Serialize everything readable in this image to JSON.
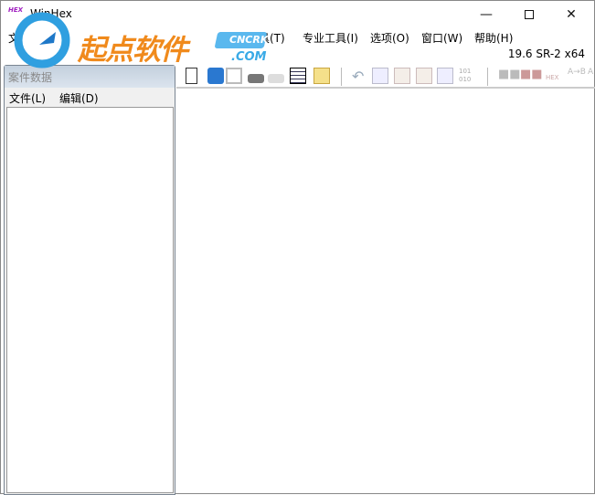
{
  "window": {
    "title": "WinHex",
    "app_icon_text": "HEX",
    "controls": [
      "minimize",
      "maximize",
      "close"
    ]
  },
  "menubar": {
    "items": [
      "文",
      "具(T)",
      "专业工具(I)",
      "选项(O)",
      "窗口(W)",
      "帮助(H)"
    ]
  },
  "version": "19.6 SR-2 x64",
  "toolbar": {
    "icons": [
      "new-file",
      "open",
      "save",
      "disk",
      "print",
      "properties",
      "export",
      "undo",
      "copy",
      "paste",
      "paste-special",
      "compare",
      "binary-convert",
      "find",
      "find-hex",
      "find-hex-2",
      "replace",
      "replace-hex"
    ]
  },
  "case_window": {
    "title": "案件数据",
    "menu": [
      "文件(L)",
      "编辑(D)"
    ]
  },
  "watermark": {
    "text": "起点软件",
    "badge": "CNCRK",
    "domain": ".COM",
    "colors": {
      "orange": "#f08a1c",
      "blue": "#3aaae6"
    }
  }
}
